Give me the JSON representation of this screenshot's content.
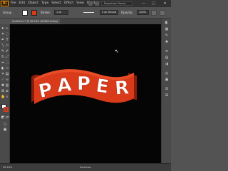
{
  "app": {
    "logo": "Ai",
    "menu": [
      "File",
      "Edit",
      "Object",
      "Type",
      "Select",
      "Effect",
      "View",
      "Window",
      "Help"
    ],
    "workspace": "Essentials Classic",
    "window_buttons": [
      "—",
      "□",
      "✕"
    ]
  },
  "control_bar": {
    "selection_label": "Group",
    "stroke_label": "Stroke:",
    "stroke_width": "1 pt",
    "brush_label": "5 pt. Round",
    "opacity_label": "Opacity:",
    "opacity_value": "100%",
    "fill_color": "#ffffff",
    "stroke_color": "#d93a1a"
  },
  "document": {
    "tab_title": "Untitled-1* @ 56.16% (RGB/Preview)"
  },
  "toolbar": {
    "tools": [
      "selection-tool",
      "direct-selection-tool",
      "magic-wand-tool",
      "pen-tool",
      "type-tool",
      "line-tool",
      "rectangle-tool",
      "paintbrush-tool",
      "pencil-tool",
      "rotate-tool",
      "scale-tool",
      "width-tool",
      "free-transform-tool",
      "shape-builder-tool",
      "perspective-tool",
      "mesh-tool",
      "gradient-tool",
      "eyedropper-tool",
      "blend-tool",
      "symbol-sprayer-tool",
      "column-graph-tool",
      "artboard-tool",
      "slice-tool",
      "hand-tool",
      "zoom-tool"
    ]
  },
  "artwork": {
    "text": "PAPER",
    "ribbon_color": "#d93a1a",
    "ribbon_shade": "#8a1c0a",
    "text_color": "#ffffff"
  },
  "status_bar": {
    "zoom": "56.16%",
    "tool": "Selection"
  }
}
